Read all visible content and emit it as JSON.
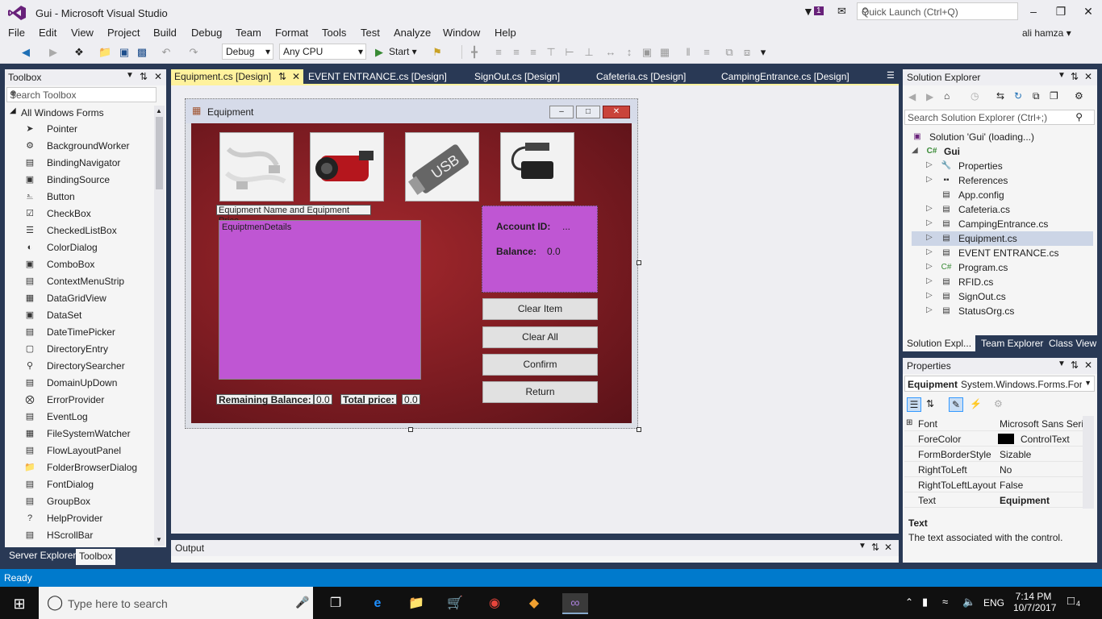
{
  "window": {
    "title": "Gui - Microsoft Visual Studio",
    "notification_count": "1",
    "quick_launch_placeholder": "Quick Launch (Ctrl+Q)",
    "user": "ali hamza"
  },
  "menu": [
    "File",
    "Edit",
    "View",
    "Project",
    "Build",
    "Debug",
    "Team",
    "Format",
    "Tools",
    "Test",
    "Analyze",
    "Window",
    "Help"
  ],
  "toolbar": {
    "config": "Debug",
    "platform": "Any CPU",
    "start_label": "Start"
  },
  "toolbox": {
    "title": "Toolbox",
    "search_placeholder": "Search Toolbox",
    "group": "All Windows Forms",
    "items": [
      {
        "label": "Pointer",
        "icon": "pointer-icon"
      },
      {
        "label": "BackgroundWorker",
        "icon": "backgroundworker-icon"
      },
      {
        "label": "BindingNavigator",
        "icon": "bindingnavigator-icon"
      },
      {
        "label": "BindingSource",
        "icon": "bindingsource-icon"
      },
      {
        "label": "Button",
        "icon": "button-icon"
      },
      {
        "label": "CheckBox",
        "icon": "checkbox-icon"
      },
      {
        "label": "CheckedListBox",
        "icon": "checkedlistbox-icon"
      },
      {
        "label": "ColorDialog",
        "icon": "colordialog-icon"
      },
      {
        "label": "ComboBox",
        "icon": "combobox-icon"
      },
      {
        "label": "ContextMenuStrip",
        "icon": "contextmenustrip-icon"
      },
      {
        "label": "DataGridView",
        "icon": "datagridview-icon"
      },
      {
        "label": "DataSet",
        "icon": "dataset-icon"
      },
      {
        "label": "DateTimePicker",
        "icon": "datetimepicker-icon"
      },
      {
        "label": "DirectoryEntry",
        "icon": "directoryentry-icon"
      },
      {
        "label": "DirectorySearcher",
        "icon": "directorysearcher-icon"
      },
      {
        "label": "DomainUpDown",
        "icon": "domainupdown-icon"
      },
      {
        "label": "ErrorProvider",
        "icon": "errorprovider-icon"
      },
      {
        "label": "EventLog",
        "icon": "eventlog-icon"
      },
      {
        "label": "FileSystemWatcher",
        "icon": "filesystemwatcher-icon"
      },
      {
        "label": "FlowLayoutPanel",
        "icon": "flowlayoutpanel-icon"
      },
      {
        "label": "FolderBrowserDialog",
        "icon": "folderbrowserdialog-icon"
      },
      {
        "label": "FontDialog",
        "icon": "fontdialog-icon"
      },
      {
        "label": "GroupBox",
        "icon": "groupbox-icon"
      },
      {
        "label": "HelpProvider",
        "icon": "helpprovider-icon"
      },
      {
        "label": "HScrollBar",
        "icon": "hscrollbar-icon"
      }
    ],
    "bottom_tabs": [
      "Server Explorer",
      "Toolbox"
    ]
  },
  "doc_tabs": [
    "Equipment.cs [Design]",
    "EVENT ENTRANCE.cs [Design]",
    "SignOut.cs [Design]",
    "Cafeteria.cs [Design]",
    "CampingEntrance.cs [Design]"
  ],
  "form": {
    "title": "Equipment",
    "pictures": [
      "usb-cables-image",
      "video-camera-image",
      "usb-drive-image",
      "power-adapter-image"
    ],
    "usb_text": "USB",
    "equip_label": "Equipment Name and  Equipment Price",
    "listbox_text": "EquiptmenDetails",
    "account_id_label": "Account  ID:",
    "account_id_value": "...",
    "balance_label": "Balance:",
    "balance_value": "0.0",
    "buttons": [
      "Clear Item",
      "Clear All",
      "Confirm",
      "Return"
    ],
    "remaining_label": "Remaining Balance:",
    "remaining_value": "0.0",
    "total_label": "Total price:",
    "total_value": "0.0"
  },
  "solution_explorer": {
    "title": "Solution Explorer",
    "search_placeholder": "Search Solution Explorer (Ctrl+;)",
    "solution": "Solution 'Gui' (loading...)",
    "project": "Gui",
    "items": [
      {
        "label": "Properties",
        "icon": "wrench-icon"
      },
      {
        "label": "References",
        "icon": "references-icon"
      },
      {
        "label": "App.config",
        "icon": "config-file-icon"
      },
      {
        "label": "Cafeteria.cs",
        "icon": "form-file-icon"
      },
      {
        "label": "CampingEntrance.cs",
        "icon": "form-file-icon"
      },
      {
        "label": "Equipment.cs",
        "icon": "form-file-icon"
      },
      {
        "label": "EVENT ENTRANCE.cs",
        "icon": "form-file-icon"
      },
      {
        "label": "Program.cs",
        "icon": "csharp-file-icon"
      },
      {
        "label": "RFID.cs",
        "icon": "form-file-icon"
      },
      {
        "label": "SignOut.cs",
        "icon": "form-file-icon"
      },
      {
        "label": "StatusOrg.cs",
        "icon": "form-file-icon"
      }
    ],
    "tabs": [
      "Solution Expl...",
      "Team Explorer",
      "Class View"
    ]
  },
  "properties": {
    "title": "Properties",
    "object": "Equipment",
    "type": "System.Windows.Forms.Form",
    "rows": [
      {
        "key": "Font",
        "value": "Microsoft Sans Serif"
      },
      {
        "key": "ForeColor",
        "value": "ControlText"
      },
      {
        "key": "FormBorderStyle",
        "value": "Sizable"
      },
      {
        "key": "RightToLeft",
        "value": "No"
      },
      {
        "key": "RightToLeftLayout",
        "value": "False"
      },
      {
        "key": "Text",
        "value": "Equipment"
      }
    ],
    "desc_title": "Text",
    "desc_text": "The text associated with the control."
  },
  "output": {
    "title": "Output"
  },
  "status": "Ready",
  "taskbar": {
    "search_placeholder": "Type here to search",
    "lang": "ENG",
    "time": "7:14 PM",
    "date": "10/7/2017",
    "notifications": "4"
  }
}
